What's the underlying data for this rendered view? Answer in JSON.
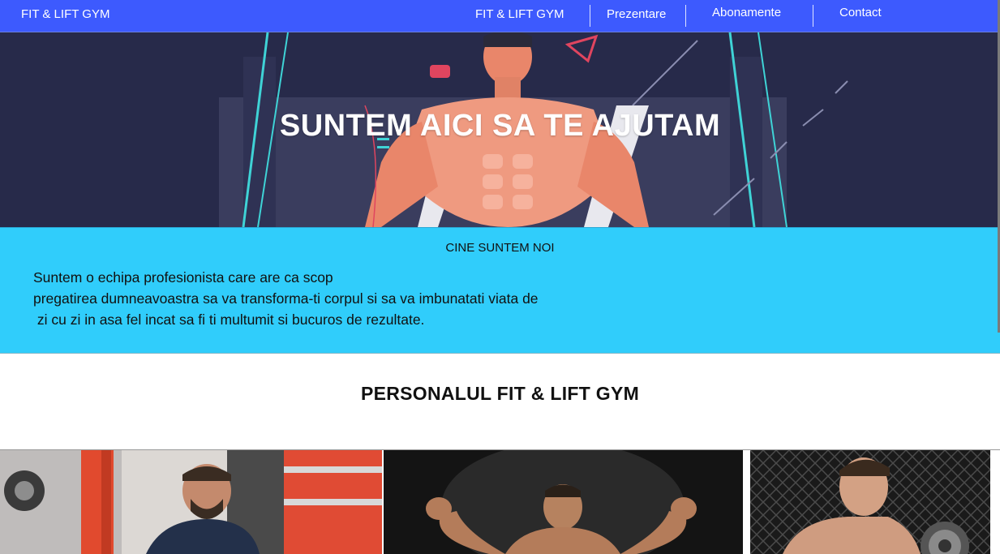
{
  "navbar": {
    "brand": "FIT & LIFT GYM",
    "items": [
      {
        "label": "FIT & LIFT GYM"
      },
      {
        "label": "Prezentare"
      },
      {
        "label": "Abonamente"
      },
      {
        "label": "Contact"
      }
    ],
    "background_color": "#3d5afe"
  },
  "hero": {
    "title": "SUNTEM AICI SA TE AJUTAM"
  },
  "about": {
    "title": "CINE SUNTEM NOI",
    "lines": [
      "Suntem o echipa profesionista care are ca scop",
      "pregatirea dumneavoastra sa va transforma-ti corpul si sa va imbunatati viata de",
      " zi cu zi in asa fel incat sa fi ti multumit si bucuros de rezultate."
    ],
    "background_color": "#30cdfb"
  },
  "staff": {
    "title": "PERSONALUL FIT & LIFT GYM",
    "photos": [
      "trainer-photo-1",
      "trainer-photo-2",
      "trainer-photo-3"
    ]
  }
}
